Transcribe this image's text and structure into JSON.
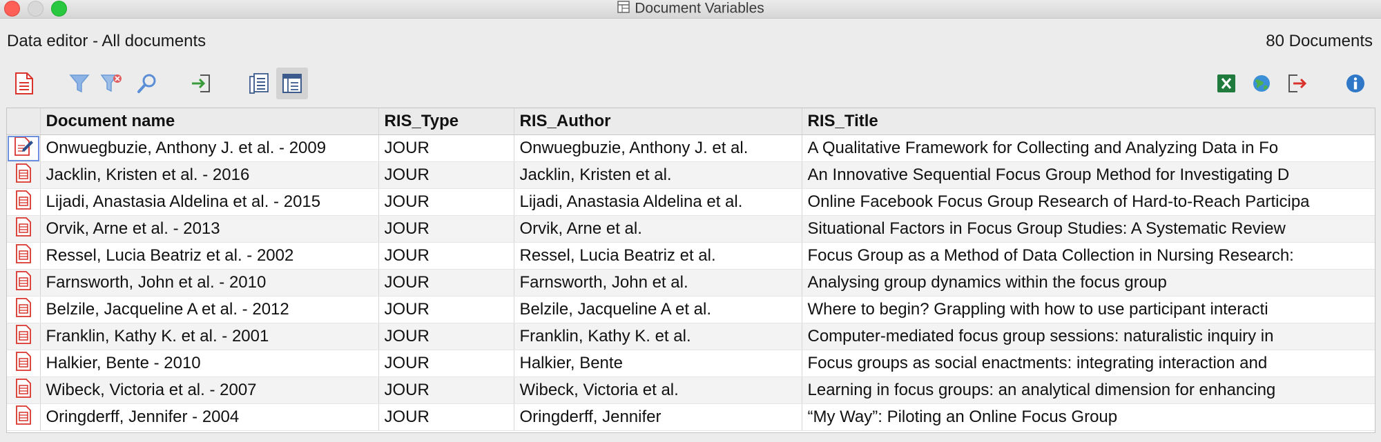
{
  "window": {
    "title": "Document Variables"
  },
  "header": {
    "left": "Data editor - All documents",
    "right": "80 Documents"
  },
  "toolbar": {
    "left": [
      {
        "name": "new-document-variable-icon",
        "color": "#d9332b"
      },
      {
        "name": "filter-icon",
        "color": "#6b9ad6"
      },
      {
        "name": "clear-filter-icon",
        "color": "#e06060"
      },
      {
        "name": "search-icon",
        "color": "#5a8ed6"
      },
      {
        "name": "import-icon",
        "color": "#3a9b3a"
      },
      {
        "name": "list-variables-icon",
        "color": "#3c5b8c"
      },
      {
        "name": "data-editor-icon",
        "color": "#3c5b8c"
      }
    ],
    "right": [
      {
        "name": "excel-export-icon",
        "color": "#1f7a3c"
      },
      {
        "name": "web-export-icon",
        "color": "#3b8fd6"
      },
      {
        "name": "export-icon",
        "color": "#d9332b"
      },
      {
        "name": "info-icon",
        "color": "#2f78c8"
      }
    ]
  },
  "table": {
    "columns": [
      "Document name",
      "RIS_Type",
      "RIS_Author",
      "RIS_Title"
    ],
    "rows": [
      {
        "name": "Onwuegbuzie, Anthony J. et al. - 2009",
        "type": "JOUR",
        "author": "Onwuegbuzie, Anthony J. et al.",
        "title": "A Qualitative Framework for Collecting and Analyzing Data in Fo",
        "editing": true
      },
      {
        "name": "Jacklin, Kristen et al. - 2016",
        "type": "JOUR",
        "author": "Jacklin, Kristen et al.",
        "title": "An Innovative Sequential Focus Group Method for Investigating D"
      },
      {
        "name": "Lijadi, Anastasia Aldelina et al. - 2015",
        "type": "JOUR",
        "author": "Lijadi, Anastasia Aldelina et al.",
        "title": "Online Facebook Focus Group Research of Hard-to-Reach Participa"
      },
      {
        "name": "Orvik, Arne et al. - 2013",
        "type": "JOUR",
        "author": "Orvik, Arne et al.",
        "title": "Situational Factors in Focus Group Studies: A Systematic Review"
      },
      {
        "name": "Ressel, Lucia Beatriz et al. - 2002",
        "type": "JOUR",
        "author": "Ressel, Lucia Beatriz et al.",
        "title": "Focus Group as a Method of Data Collection in Nursing Research:"
      },
      {
        "name": "Farnsworth, John et al. - 2010",
        "type": "JOUR",
        "author": "Farnsworth, John et al.",
        "title": "Analysing group dynamics within the focus group"
      },
      {
        "name": "Belzile, Jacqueline A et al. - 2012",
        "type": "JOUR",
        "author": "Belzile, Jacqueline A et al.",
        "title": "Where to begin? Grappling with how to use participant interacti"
      },
      {
        "name": "Franklin, Kathy K. et al. - 2001",
        "type": "JOUR",
        "author": "Franklin, Kathy K. et al.",
        "title": "Computer-mediated focus group sessions: naturalistic inquiry in"
      },
      {
        "name": "Halkier, Bente - 2010",
        "type": "JOUR",
        "author": "Halkier, Bente",
        "title": "Focus groups as social enactments: integrating interaction and"
      },
      {
        "name": "Wibeck, Victoria et al. - 2007",
        "type": "JOUR",
        "author": "Wibeck, Victoria et al.",
        "title": "Learning in focus groups: an analytical dimension for enhancing"
      },
      {
        "name": "Oringderff, Jennifer - 2004",
        "type": "JOUR",
        "author": "Oringderff, Jennifer",
        "title": "“My Way”: Piloting an Online Focus Group"
      }
    ]
  }
}
